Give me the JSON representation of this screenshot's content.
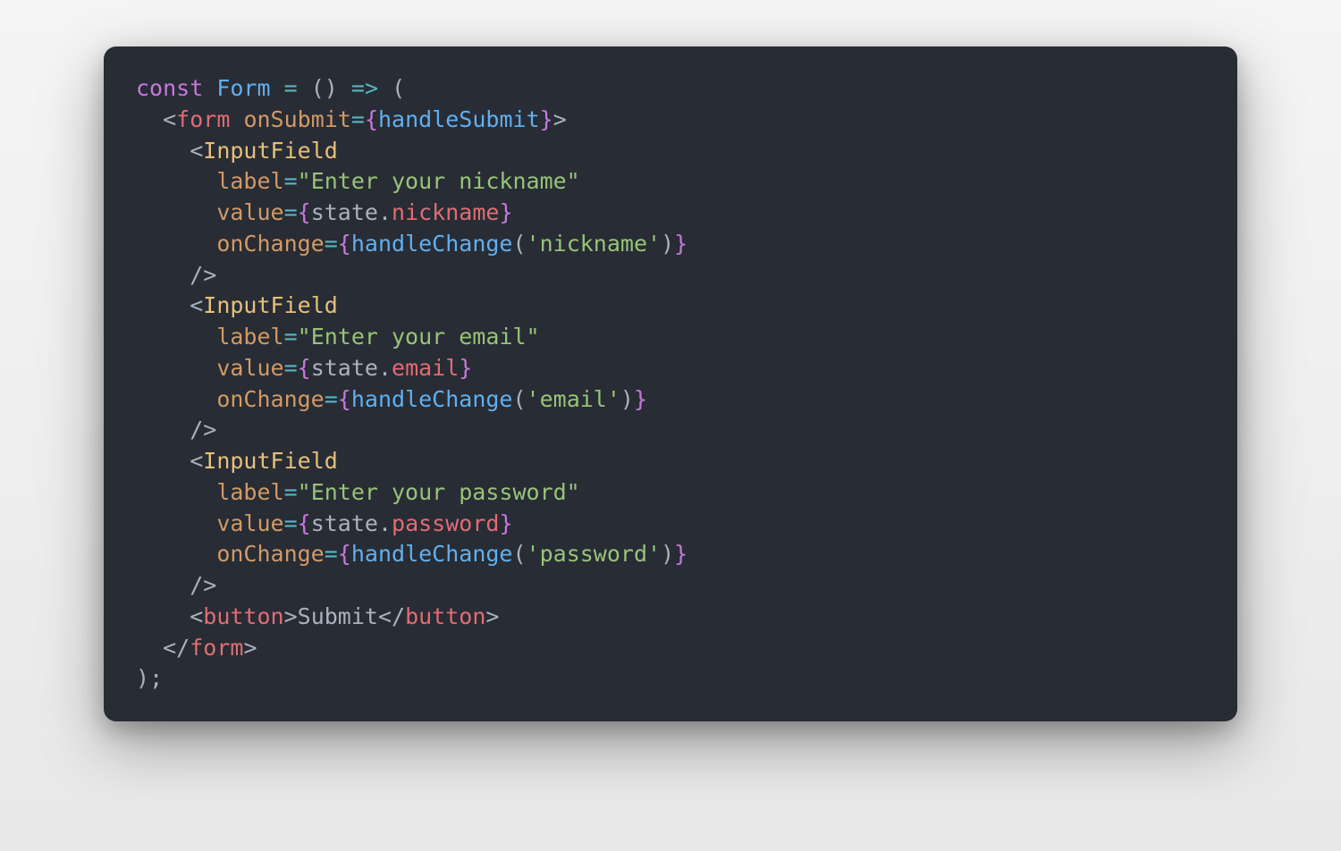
{
  "code": {
    "l1": {
      "kw": "const",
      "name": "Form",
      "eq": "=",
      "par": "()",
      "arrow": "=>",
      "open": "("
    },
    "l2": {
      "open": "<",
      "tag": "form",
      "attr": "onSubmit",
      "eq": "=",
      "bo": "{",
      "fn": "handleSubmit",
      "bc": "}",
      "gt": ">"
    },
    "l3": {
      "open": "<",
      "tag": "InputField"
    },
    "l4": {
      "attr": "label",
      "eq": "=",
      "str": "\"Enter your nickname\""
    },
    "l5": {
      "attr": "value",
      "eq": "=",
      "bo": "{",
      "obj": "state",
      "dot": ".",
      "prop": "nickname",
      "bc": "}"
    },
    "l6": {
      "attr": "onChange",
      "eq": "=",
      "bo": "{",
      "fn": "handleChange",
      "po": "(",
      "str": "'nickname'",
      "pc": ")",
      "bc": "}"
    },
    "l7": {
      "close": "/>"
    },
    "l8": {
      "open": "<",
      "tag": "InputField"
    },
    "l9": {
      "attr": "label",
      "eq": "=",
      "str": "\"Enter your email\""
    },
    "l10": {
      "attr": "value",
      "eq": "=",
      "bo": "{",
      "obj": "state",
      "dot": ".",
      "prop": "email",
      "bc": "}"
    },
    "l11": {
      "attr": "onChange",
      "eq": "=",
      "bo": "{",
      "fn": "handleChange",
      "po": "(",
      "str": "'email'",
      "pc": ")",
      "bc": "}"
    },
    "l12": {
      "close": "/>"
    },
    "l13": {
      "open": "<",
      "tag": "InputField"
    },
    "l14": {
      "attr": "label",
      "eq": "=",
      "str": "\"Enter your password\""
    },
    "l15": {
      "attr": "value",
      "eq": "=",
      "bo": "{",
      "obj": "state",
      "dot": ".",
      "prop": "password",
      "bc": "}"
    },
    "l16": {
      "attr": "onChange",
      "eq": "=",
      "bo": "{",
      "fn": "handleChange",
      "po": "(",
      "str": "'password'",
      "pc": ")",
      "bc": "}"
    },
    "l17": {
      "close": "/>"
    },
    "l18": {
      "open": "<",
      "tag": "button",
      "gt": ">",
      "text": "Submit",
      "open2": "</",
      "tag2": "button",
      "gt2": ">"
    },
    "l19": {
      "open": "</",
      "tag": "form",
      "gt": ">"
    },
    "l20": {
      "close": ")",
      "semi": ";"
    }
  }
}
